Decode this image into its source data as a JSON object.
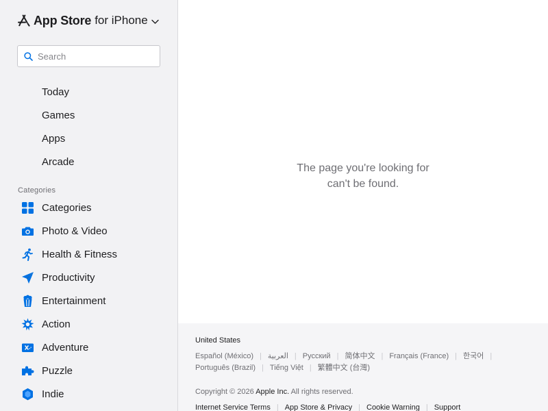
{
  "brand": {
    "name": "App Store",
    "subtitle": "for iPhone",
    "logo_icon": "app-store-logo-icon",
    "chevron_icon": "chevron-down-icon"
  },
  "search": {
    "placeholder": "Search",
    "value": "",
    "icon": "search-icon"
  },
  "nav": {
    "items": [
      {
        "label": "Today"
      },
      {
        "label": "Games"
      },
      {
        "label": "Apps"
      },
      {
        "label": "Arcade"
      }
    ]
  },
  "categories": {
    "heading": "Categories",
    "items": [
      {
        "label": "Categories",
        "icon": "grid-icon"
      },
      {
        "label": "Photo & Video",
        "icon": "camera-icon"
      },
      {
        "label": "Health & Fitness",
        "icon": "running-person-icon"
      },
      {
        "label": "Productivity",
        "icon": "paper-plane-icon"
      },
      {
        "label": "Entertainment",
        "icon": "popcorn-icon"
      },
      {
        "label": "Action",
        "icon": "burst-icon"
      },
      {
        "label": "Adventure",
        "icon": "treasure-map-icon"
      },
      {
        "label": "Puzzle",
        "icon": "puzzle-piece-icon"
      },
      {
        "label": "Indie",
        "icon": "hexagon-gem-icon"
      }
    ]
  },
  "main": {
    "message_line1": "The page you're looking for",
    "message_line2": "can't be found."
  },
  "footer": {
    "country": "United States",
    "languages": [
      "Español (México)",
      "العربية",
      "Русский",
      "简体中文",
      "Français (France)",
      "한국어",
      "Português (Brazil)",
      "Tiếng Việt",
      "繁體中文 (台灣)"
    ],
    "copyright_prefix": "Copyright © 2026",
    "company": "Apple Inc.",
    "rights": "All rights reserved.",
    "legal_links": [
      "Internet Service Terms",
      "App Store & Privacy",
      "Cookie Warning",
      "Support"
    ]
  },
  "colors": {
    "accent": "#0071e3",
    "sidebar_bg": "#f2f2f4",
    "footer_bg": "#f5f5f7",
    "text": "#1d1d1f",
    "muted_text": "#6e6e73"
  }
}
